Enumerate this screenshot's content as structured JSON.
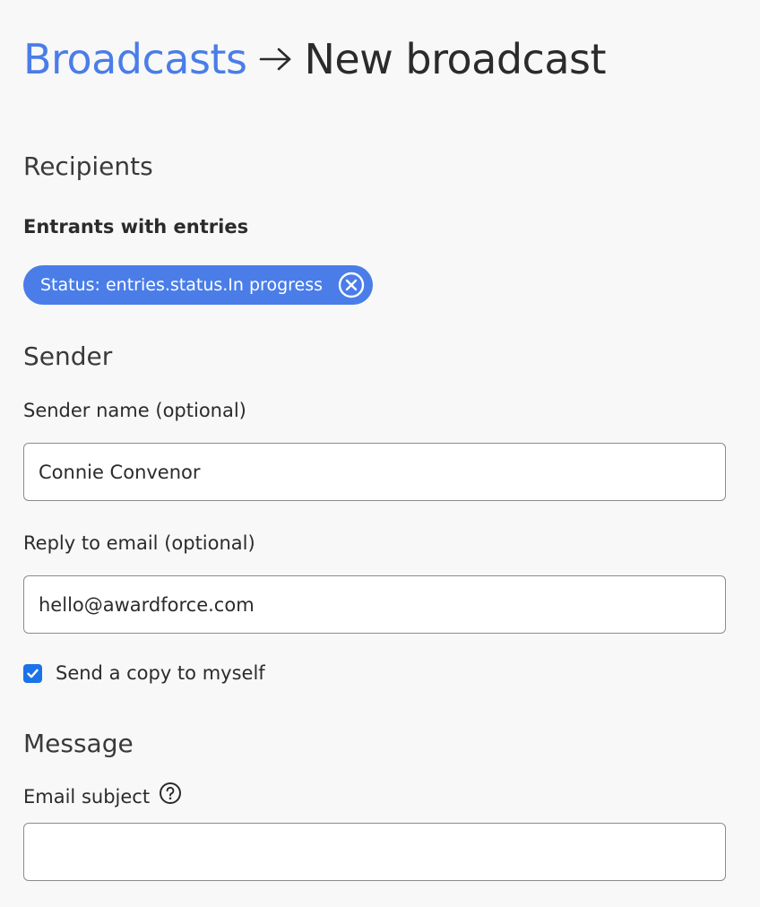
{
  "breadcrumb": {
    "parent_label": "Broadcasts",
    "current_label": "New broadcast",
    "link_color": "#4a7de8",
    "separator_icon": "arrow-right-icon"
  },
  "recipients": {
    "heading": "Recipients",
    "group_label": "Entrants with entries",
    "filter_chip": {
      "label": "Status: entries.status.In progress",
      "color": "#4a7de8",
      "remove_icon": "close-circle-icon"
    }
  },
  "sender": {
    "heading": "Sender",
    "sender_name": {
      "label": "Sender name",
      "optional_text": "(optional)",
      "value": "Connie Convenor"
    },
    "reply_to": {
      "label": "Reply to email",
      "optional_text": "(optional)",
      "value": "hello@awardforce.com"
    },
    "send_copy": {
      "label": "Send a copy to myself",
      "checked": true,
      "color": "#1a73e8"
    }
  },
  "message": {
    "heading": "Message",
    "email_subject": {
      "label": "Email subject",
      "help_icon": "help-circle-icon",
      "value": ""
    }
  }
}
